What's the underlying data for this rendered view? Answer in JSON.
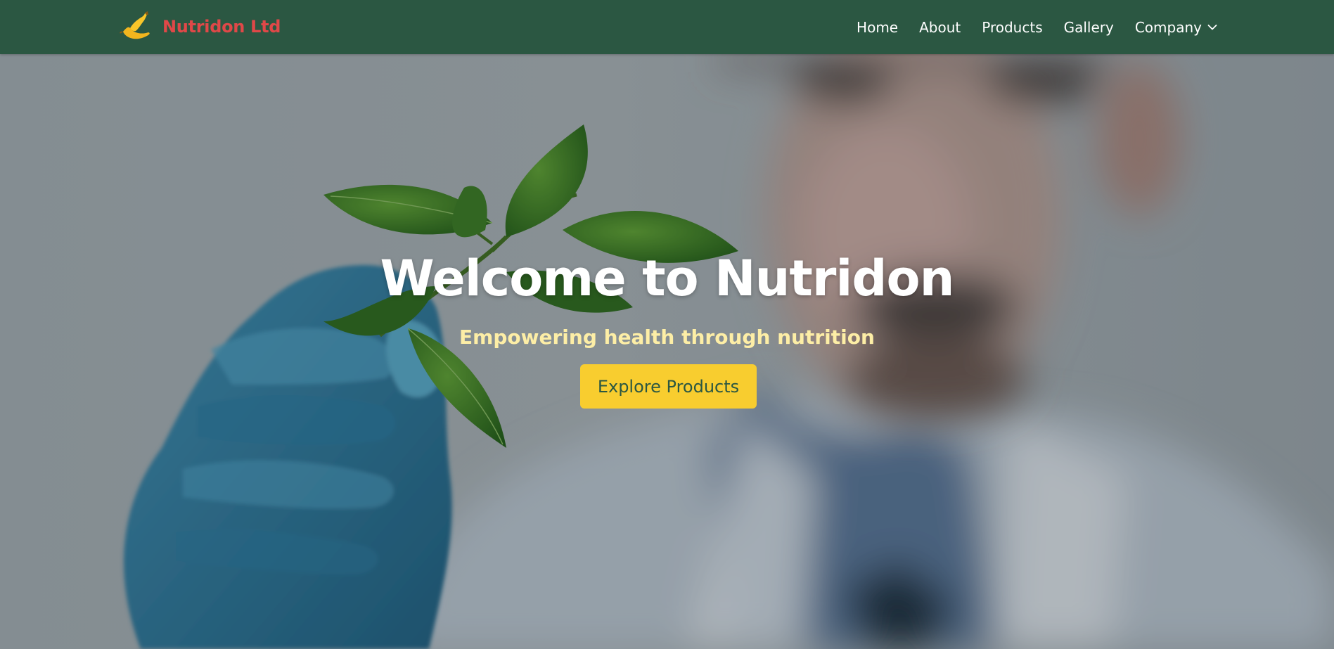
{
  "brand": {
    "name": "Nutridon Ltd",
    "logo_icon": "banana-icon",
    "name_color": "#e04848"
  },
  "nav": {
    "items": [
      {
        "label": "Home"
      },
      {
        "label": "About"
      },
      {
        "label": "Products"
      },
      {
        "label": "Gallery"
      },
      {
        "label": "Company",
        "icon": "chevron-down-icon"
      }
    ]
  },
  "hero": {
    "title": "Welcome to Nutridon",
    "subtitle": "Empowering health through nutrition",
    "cta_label": "Explore Products",
    "background_image": "photo of scientist in lab coat with blue gloves holding green leaves"
  },
  "colors": {
    "navbar": "#2b5742",
    "accent_yellow": "#f8cd2f",
    "subtitle_cream": "#fdeea6"
  }
}
